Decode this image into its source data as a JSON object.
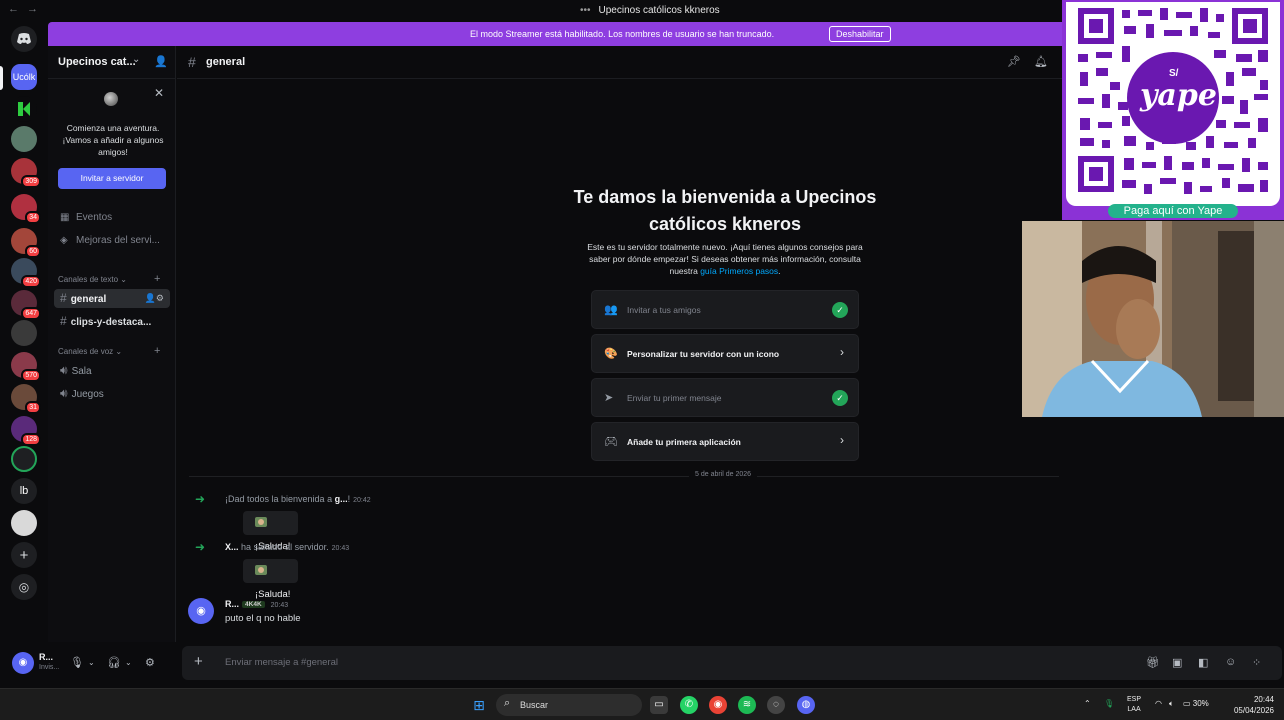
{
  "window": {
    "title": "Upecinos católicos kkneros"
  },
  "banner": {
    "text": "El modo Streamer está habilitado. Los nombres de usuario se han truncado.",
    "button": "Deshabilitar"
  },
  "rail": {
    "servers": [
      {
        "label": "Ucólk"
      },
      {
        "label": "",
        "badge": "309"
      },
      {
        "label": "",
        "badge": "34"
      },
      {
        "label": "",
        "badge": "60"
      },
      {
        "label": "",
        "badge": "420"
      },
      {
        "label": "",
        "badge": "647"
      },
      {
        "label": "",
        "badge": "570"
      },
      {
        "label": "",
        "badge": "31"
      },
      {
        "label": "",
        "badge": "128"
      },
      {
        "label": "lb"
      }
    ]
  },
  "sidebar": {
    "server_name": "Upecinos cat...",
    "welcome_text": "Comienza una aventura. ¡Vamos a añadir a algunos amigos!",
    "invite_button": "Invitar a servidor",
    "events": "Eventos",
    "boosts": "Mejoras del servi...",
    "text_category": "Canales de texto",
    "text_channels": [
      "general",
      "clips-y-destaca..."
    ],
    "voice_category": "Canales de voz",
    "voice_channels": [
      "Sala",
      "Juegos"
    ]
  },
  "user": {
    "name": "R...",
    "status": "Invis..."
  },
  "channel": {
    "name": "general"
  },
  "welcome": {
    "title": "Te damos la bienvenida a Upecinos católicos kkneros",
    "desc_before": "Este es tu servidor totalmente nuevo. ¡Aquí tienes algunos consejos para saber por dónde empezar! Si deseas obtener más información, consulta nuestra",
    "desc_link": "guía Primeros pasos",
    "tasks": [
      {
        "label": "Invitar a tus amigos",
        "done": true
      },
      {
        "label": "Personalizar tu servidor con un icono",
        "done": false
      },
      {
        "label": "Enviar tu primer mensaje",
        "done": true
      },
      {
        "label": "Añade tu primera aplicación",
        "done": false
      }
    ]
  },
  "messages": {
    "date_divider": "5 de abril de 2026",
    "join1": {
      "before": "¡Dad todos la bienvenida a",
      "user": "g...",
      "after": "!",
      "time": "20:42"
    },
    "join2": {
      "user": "X...",
      "after": "ha saltado al servidor.",
      "time": "20:43"
    },
    "wave_label": "¡Saluda!",
    "chat": {
      "user": "R...",
      "tag": "4K4K",
      "time": "20:43",
      "body": "puto el q no hable"
    }
  },
  "composer": {
    "placeholder": "Enviar mensaje a #general"
  },
  "overlay": {
    "qr_brand": "yape",
    "qr_currency": "S/",
    "pay_label": "Paga aquí con Yape"
  },
  "taskbar": {
    "search": "Buscar",
    "lang1": "ESP",
    "lang2": "LAA",
    "battery": "30%",
    "time": "20:44",
    "date": "05/04/2026"
  },
  "colors": {
    "accent": "#5865f2",
    "banner": "#8e3ee0",
    "success": "#23a559",
    "yape": "#8b32d6"
  }
}
